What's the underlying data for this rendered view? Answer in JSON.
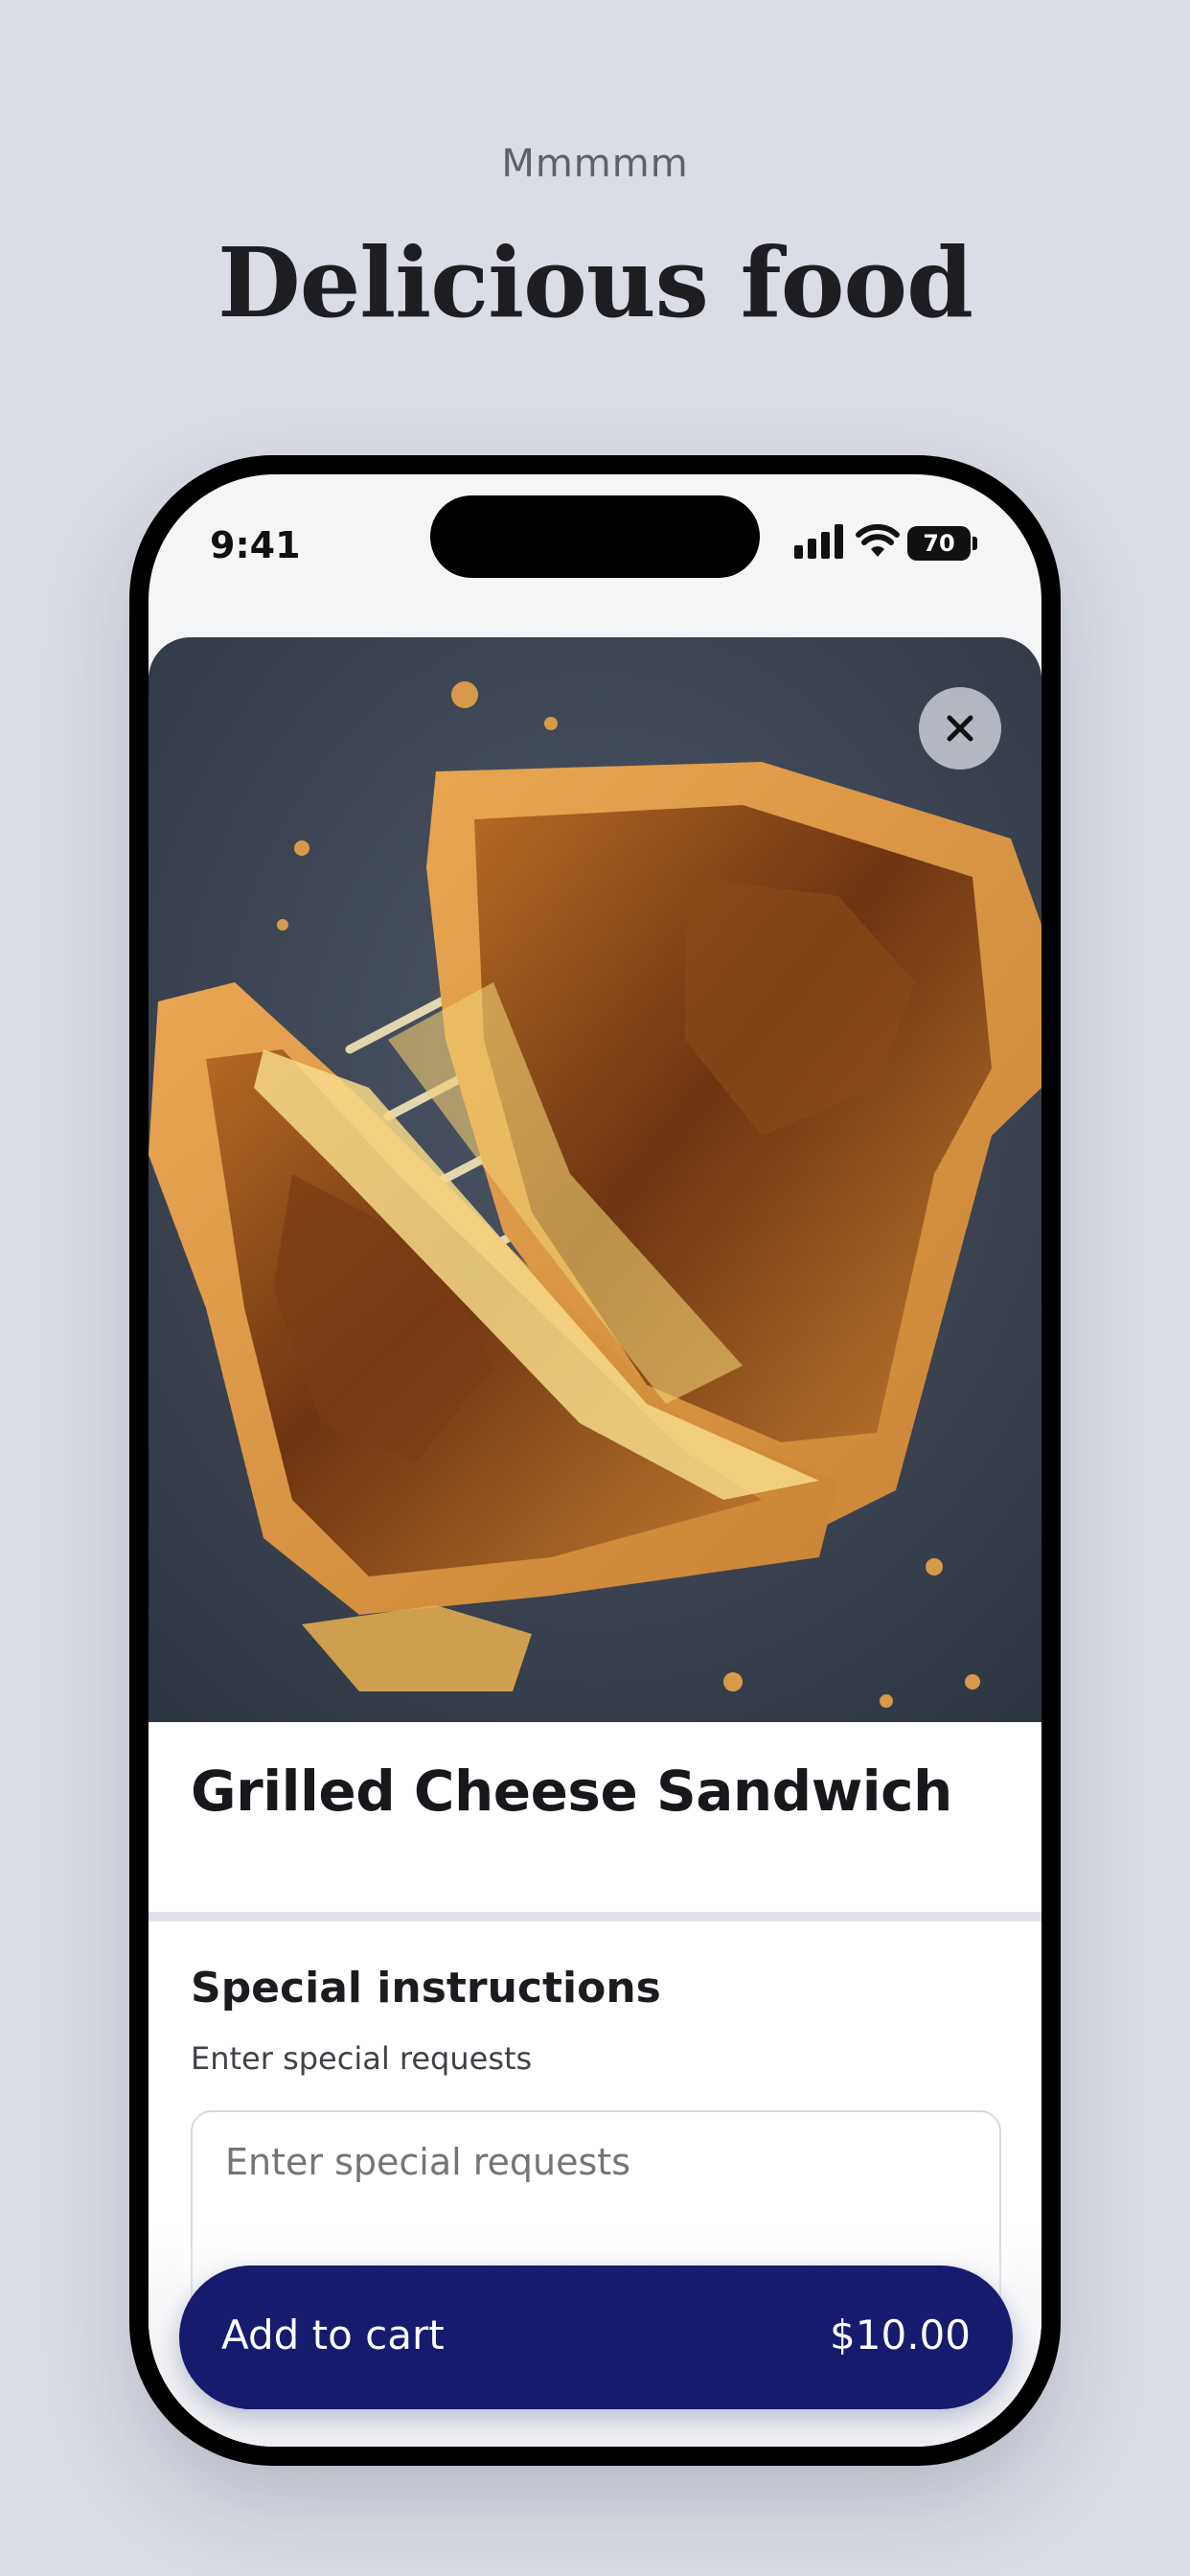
{
  "page": {
    "eyebrow": "Mmmmm",
    "headline": "Delicious food"
  },
  "status_bar": {
    "time": "9:41",
    "battery": "70",
    "icons": [
      "signal-icon",
      "wifi-icon",
      "battery-icon"
    ]
  },
  "item": {
    "image": "grilled-cheese-photo",
    "close_icon": "close-icon",
    "title": "Grilled Cheese Sandwich"
  },
  "special_instructions": {
    "title": "Special instructions",
    "subtitle": "Enter special requests",
    "placeholder": "Enter special requests"
  },
  "cart": {
    "label": "Add to cart",
    "price": "$10.00",
    "color": "#161b6e"
  }
}
